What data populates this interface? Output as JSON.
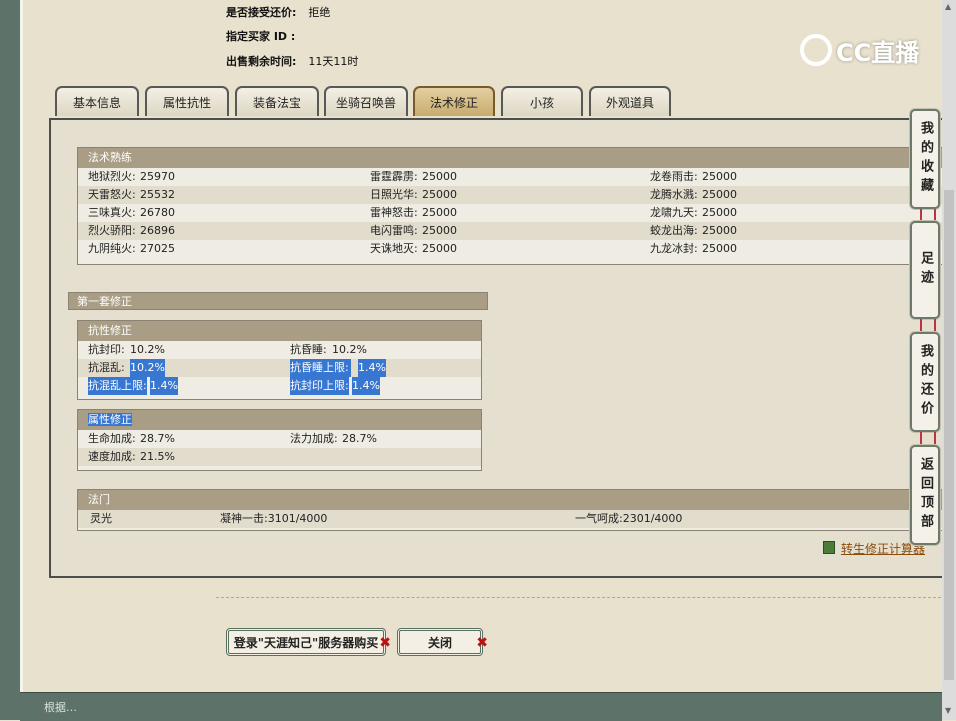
{
  "info": {
    "accept_label": "是否接受还价:",
    "accept_value": "拒绝",
    "buyer_label": "指定买家 ID :",
    "time_label": "出售剩余时间:",
    "time_value": "11天11时"
  },
  "logo": {
    "text": "CC直播"
  },
  "tabs": [
    {
      "label": "基本信息"
    },
    {
      "label": "属性抗性"
    },
    {
      "label": "装备法宝"
    },
    {
      "label": "坐骑召唤兽"
    },
    {
      "label": "法术修正",
      "active": true
    },
    {
      "label": "小孩"
    },
    {
      "label": "外观道具"
    }
  ],
  "spell": {
    "title": "法术熟练",
    "rows": [
      [
        "地狱烈火:",
        "25970",
        "雷霆霹雳:",
        "25000",
        "龙卷雨击:",
        "25000"
      ],
      [
        "天雷怒火:",
        "25532",
        "日照光华:",
        "25000",
        "龙腾水溅:",
        "25000"
      ],
      [
        "三味真火:",
        "26780",
        "雷神怒击:",
        "25000",
        "龙啸九天:",
        "25000"
      ],
      [
        "烈火骄阳:",
        "26896",
        "电闪雷鸣:",
        "25000",
        "蛟龙出海:",
        "25000"
      ],
      [
        "九阴纯火:",
        "27025",
        "天诛地灭:",
        "25000",
        "九龙冰封:",
        "25000"
      ]
    ]
  },
  "set": {
    "title": "第一套修正"
  },
  "resist": {
    "title": "抗性修正",
    "rows": [
      [
        "抗封印:",
        "10.2%",
        "抗昏睡:",
        "10.2%"
      ],
      [
        "抗混乱:",
        "10.2%",
        "抗昏睡上限:",
        "1.4%"
      ],
      [
        "抗混乱上限:",
        "1.4%",
        "抗封印上限:",
        "1.4%"
      ]
    ]
  },
  "attr": {
    "title": "属性修正",
    "rows": [
      [
        "生命加成:",
        "28.7%",
        "法力加成:",
        "28.7%"
      ],
      [
        "速度加成:",
        "21.5%",
        "",
        ""
      ]
    ]
  },
  "faction": {
    "title": "法门",
    "items": [
      "灵光",
      "凝神一击:3101/4000",
      "一气呵成:2301/4000"
    ]
  },
  "calc": {
    "label": "转生修正计算器"
  },
  "buttons": {
    "login": "登录\"天涯知己\"服务器购买",
    "close": "关闭"
  },
  "sidebar": [
    {
      "label": "我的收藏"
    },
    {
      "label": "足迹"
    },
    {
      "label": "我的还价"
    },
    {
      "label": "返回顶部"
    }
  ],
  "footer": {
    "text": "根据…"
  },
  "colors": {
    "frame": "#5d7268",
    "header": "#a99e85",
    "selection": "#3777d2",
    "active_tab": "#c8ab6f"
  }
}
